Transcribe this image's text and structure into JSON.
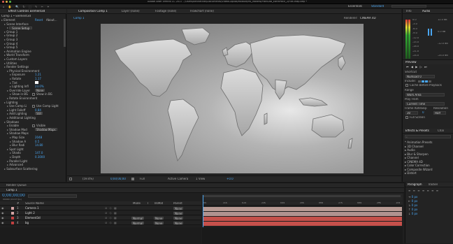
{
  "app": {
    "title": "Adobe After Effects CC 2017 - /Users/bennetinel/Documents/VideoCopilot/Module/Ms_Models/PixelLab_EarthPack_2/Flat-Map.aep *",
    "workspaces": [
      "Essentials",
      "Standard"
    ]
  },
  "effect_controls": {
    "tab": "Effect Controls Element3d",
    "layer": "Comp 1 • Element3d",
    "items": [
      {
        "i": 0,
        "text": "Element",
        "value": "Reset",
        "v2": "About..."
      },
      {
        "i": 1,
        "text": "Scene Interface"
      },
      {
        "i": 2,
        "text": "Scene Setup",
        "button": true
      },
      {
        "i": 1,
        "text": "Group 1"
      },
      {
        "i": 1,
        "text": "Group 2"
      },
      {
        "i": 1,
        "text": "Group 3"
      },
      {
        "i": 1,
        "text": "Group 4"
      },
      {
        "i": 1,
        "text": "Group 5"
      },
      {
        "i": 1,
        "text": "Animation Engine"
      },
      {
        "i": 1,
        "text": "World Transform"
      },
      {
        "i": 1,
        "text": "Custom Layers"
      },
      {
        "i": 1,
        "text": "Utilities"
      },
      {
        "i": 1,
        "text": "Render Settings"
      },
      {
        "i": 2,
        "text": "Physical Environment"
      },
      {
        "i": 3,
        "text": "Exposure",
        "value": "1.21"
      },
      {
        "i": 3,
        "text": "Rotate",
        "value": "1.17"
      },
      {
        "i": 3,
        "text": "Tint",
        "swatch": true
      },
      {
        "i": 3,
        "text": "Lighting Infl",
        "value": "23.0%"
      },
      {
        "i": 2,
        "text": "Override Layer",
        "dd": "None"
      },
      {
        "i": 3,
        "text": "Show in BG",
        "check": "Show in BG"
      },
      {
        "i": 2,
        "text": "Rotate Environment"
      },
      {
        "i": 1,
        "text": "Lighting"
      },
      {
        "i": 2,
        "text": "Use Comp Li",
        "check": "Use Comp Light"
      },
      {
        "i": 2,
        "text": "Light Falloff",
        "value": "0.84"
      },
      {
        "i": 2,
        "text": "Add Lighting",
        "dd": "Still"
      },
      {
        "i": 2,
        "text": "Additional Lighting"
      },
      {
        "i": 1,
        "text": "Shadows"
      },
      {
        "i": 2,
        "text": "Enable",
        "check": "Visible"
      },
      {
        "i": 2,
        "text": "Shadow Mod",
        "dd": "Shadow Maps"
      },
      {
        "i": 2,
        "text": "Shadow Maps"
      },
      {
        "i": 3,
        "text": "Map Size",
        "value": "2048"
      },
      {
        "i": 3,
        "text": "Shadow A",
        "value": "0.5"
      },
      {
        "i": 3,
        "text": "Blur Radi",
        "value": "14.80"
      },
      {
        "i": 2,
        "text": "Spot Light"
      },
      {
        "i": 3,
        "text": "Shado",
        "value": "147.0"
      },
      {
        "i": 3,
        "text": "Depth",
        "value": "0.3000"
      },
      {
        "i": 2,
        "text": "Parallel Light"
      },
      {
        "i": 2,
        "text": "Advanced"
      },
      {
        "i": 1,
        "text": "Subsurface Scattering"
      }
    ]
  },
  "comp_tabs": {
    "comp": "Composition Comp 1",
    "layer": "Layer (none)",
    "footage": "Footage (none)",
    "flowchart": "Flowchart (none)",
    "nav": "Comp 1",
    "renderer_label": "Renderer:",
    "renderer": "CINEMA 4D"
  },
  "viewer_footer": {
    "zoom": "(59.4%)",
    "timecode": "0;00;00;00",
    "res": "Full",
    "camera": "Active Camera",
    "views": "1 View",
    "exposure": "+0.0"
  },
  "info": {
    "tab_info": "Info",
    "tab_audio": "Audio",
    "db_left": [
      "0.0",
      "-3.0",
      "-6.0",
      "-9.0",
      "-12.0",
      "-15.0",
      "-18.0",
      "-21.0",
      "-24.0"
    ],
    "db_right": [
      "12.0 dB",
      "0.0 dB",
      "-12.0 dB",
      "-24.0 dB"
    ]
  },
  "preview": {
    "title": "Preview",
    "shortcut_label": "Shortcut",
    "shortcut": "Numpad 0",
    "include": "Include:",
    "cache": "Cache Before Playback",
    "range_label": "Range",
    "range": "Work Area",
    "play_from_label": "Play From",
    "play_from": "Current Time",
    "frame_rate": "Frame Rate",
    "skip": "Skip",
    "resolution": "Resolution",
    "fps": "30",
    "skip_val": "0",
    "res_val": "Half",
    "fullscreen": "Full Screen"
  },
  "effects": {
    "tab": "Effects & Presets",
    "chars": "Char",
    "search": "",
    "items": [
      "* Animation Presets",
      "▸ 3D Channel",
      "▸ Audio",
      "▸ Blur & Sharpen",
      "▸ Channel",
      "▸ CINEMA 4D",
      "▸ Color Correction",
      "▸ Composite Wizard",
      "▸ Distort"
    ]
  },
  "timeline": {
    "tab_render": "Render Queue",
    "tab_comp": "Comp 1",
    "timecode": "0;00;00;00",
    "fps_note": "00000 (29.97 fps)",
    "col_headers": {
      "num": "#",
      "source": "Source Name",
      "mode": "Mode",
      "t": "T",
      "trkmat": "TrkMat",
      "parent": "Parent"
    },
    "layers": [
      {
        "n": "1",
        "name": "Camera 1",
        "color": "#d4a4a4",
        "mode": "",
        "trk": "",
        "parent": "None"
      },
      {
        "n": "2",
        "name": "Light 2",
        "color": "#d4a4a4",
        "mode": "",
        "trk": "",
        "parent": "None"
      },
      {
        "n": "3",
        "name": "Element3d",
        "color": "#c04040",
        "mode": "Normal",
        "trk": "None",
        "parent": "None"
      },
      {
        "n": "4",
        "name": "bg",
        "color": "#c04040",
        "mode": "Normal",
        "trk": "None",
        "parent": "None"
      }
    ],
    "ruler": [
      "0s",
      "01s",
      "02s",
      "03s",
      "04s",
      "05s",
      "06s",
      "07s",
      "08s",
      "09s",
      "10s"
    ],
    "bars": [
      "#b79a93",
      "#b09390",
      "#c4504a",
      "#c6504b"
    ]
  },
  "paragraph": {
    "tab": "Paragraph",
    "tab2": "Tracker",
    "fields": [
      "0 px",
      "0 px",
      "0 px",
      "0 px",
      "0 px"
    ]
  },
  "colors": {
    "accent": "#2f8ce5",
    "blue_text": "#4aa6f2",
    "panel": "#232323",
    "viewer_bg": "#2a2a2a"
  }
}
